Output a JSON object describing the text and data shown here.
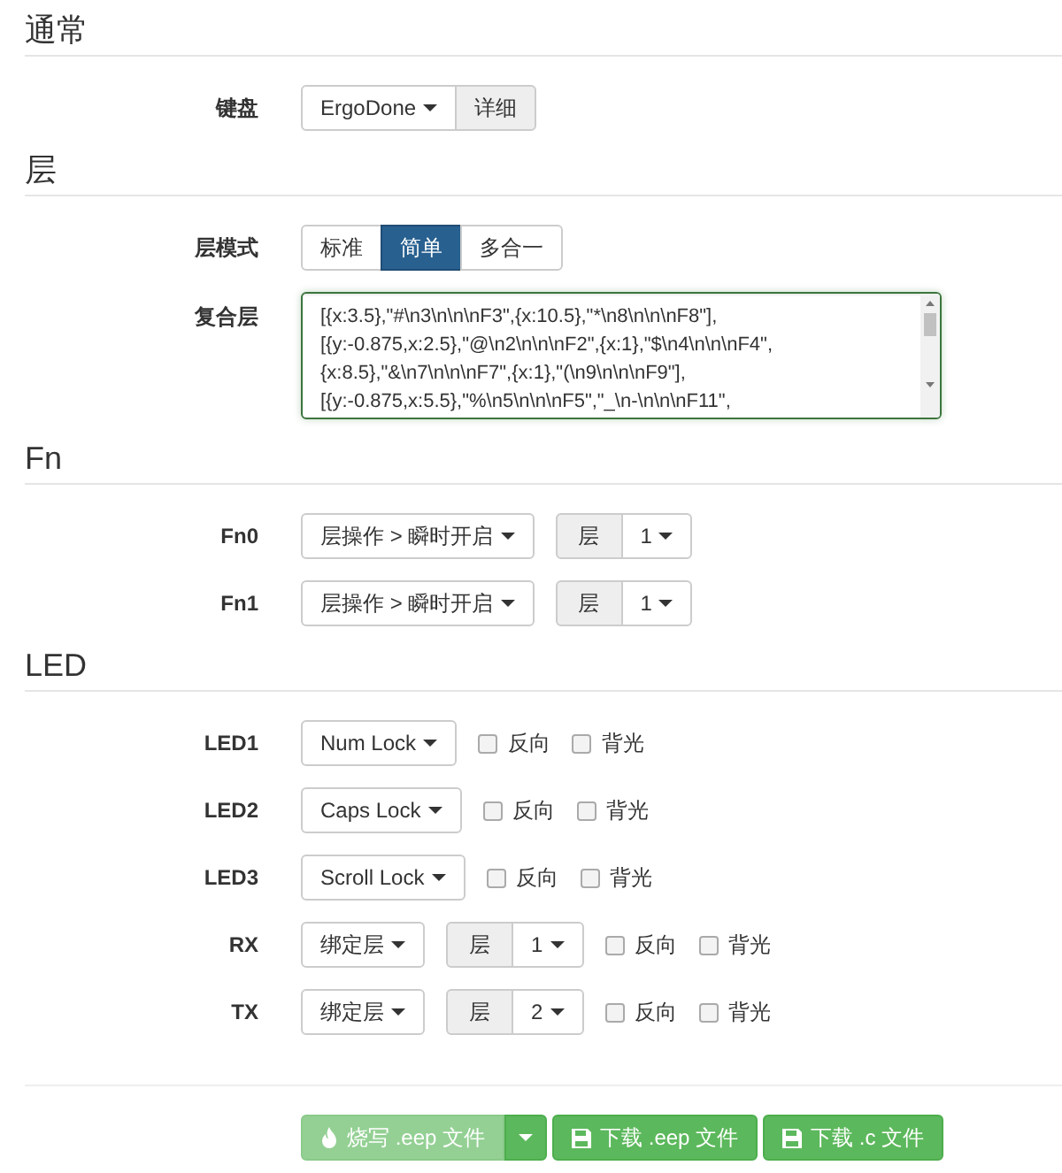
{
  "sections": [
    {
      "title": "通常",
      "rows": [
        {
          "kind": "select_addon",
          "label": "键盘",
          "value": "ErgoDone",
          "addon": "详细"
        }
      ]
    },
    {
      "title": "层",
      "rows": [
        {
          "kind": "segmented",
          "label": "层模式",
          "options": [
            {
              "label": "标准",
              "selected": false
            },
            {
              "label": "简单",
              "selected": true
            },
            {
              "label": "多合一",
              "selected": false
            }
          ]
        },
        {
          "kind": "textarea",
          "label": "复合层",
          "lines": [
            "[{x:3.5},\"#\\n3\\n\\n\\nF3\",{x:10.5},\"*\\n8\\n\\n\\nF8\"],",
            "[{y:-0.875,x:2.5},\"@\\n2\\n\\n\\nF2\",{x:1},\"$\\n4\\n\\n\\nF4\",",
            "{x:8.5},\"&\\n7\\n\\n\\nF7\",{x:1},\"(\\n9\\n\\n\\nF9\"],",
            "[{y:-0.875,x:5.5},\"%\\n5\\n\\n\\nF5\",\"_\\n-\\n\\n\\nF11\","
          ]
        }
      ]
    },
    {
      "title": "Fn",
      "rows": [
        {
          "kind": "action",
          "label": "Fn0",
          "value": "层操作 > 瞬时开启",
          "layer_label": "层",
          "layer": "1"
        },
        {
          "kind": "action",
          "label": "Fn1",
          "value": "层操作 > 瞬时开启",
          "layer_label": "层",
          "layer": "1"
        }
      ]
    },
    {
      "title": "LED",
      "rows": [
        {
          "kind": "led",
          "label": "LED1",
          "value": "Num Lock",
          "options": [
            {
              "label": "反向",
              "checked": false
            },
            {
              "label": "背光",
              "checked": false
            }
          ]
        },
        {
          "kind": "led",
          "label": "LED2",
          "value": "Caps Lock",
          "options": [
            {
              "label": "反向",
              "checked": false
            },
            {
              "label": "背光",
              "checked": false
            }
          ]
        },
        {
          "kind": "led",
          "label": "LED3",
          "value": "Scroll Lock",
          "options": [
            {
              "label": "反向",
              "checked": false
            },
            {
              "label": "背光",
              "checked": false
            }
          ]
        },
        {
          "kind": "led",
          "label": "RX",
          "value": "绑定层",
          "layer_label": "层",
          "layer": "1",
          "options": [
            {
              "label": "反向",
              "checked": false
            },
            {
              "label": "背光",
              "checked": false
            }
          ]
        },
        {
          "kind": "led",
          "label": "TX",
          "value": "绑定层",
          "layer_label": "层",
          "layer": "2",
          "options": [
            {
              "label": "反向",
              "checked": false
            },
            {
              "label": "背光",
              "checked": false
            }
          ]
        }
      ]
    }
  ],
  "actions": [
    {
      "kind": "burn",
      "label": "烧写 .eep 文件",
      "disabled": true
    },
    {
      "kind": "download",
      "label": "下载 .eep 文件",
      "disabled": false
    },
    {
      "kind": "download",
      "label": "下载 .c 文件",
      "disabled": false
    }
  ]
}
